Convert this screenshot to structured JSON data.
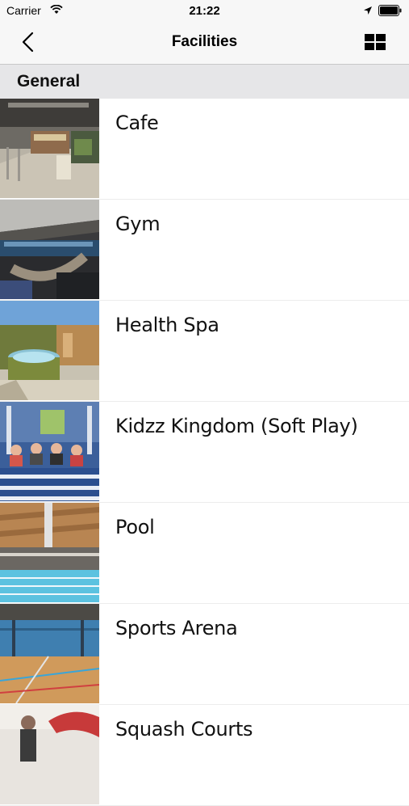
{
  "status_bar": {
    "carrier": "Carrier",
    "time": "21:22"
  },
  "nav": {
    "title": "Facilities",
    "back_icon": "chevron-left-icon",
    "grid_icon": "grid-view-icon"
  },
  "section": {
    "title": "General"
  },
  "facilities": [
    {
      "label": "Cafe",
      "image": "cafe-photo"
    },
    {
      "label": "Gym",
      "image": "gym-photo"
    },
    {
      "label": "Health Spa",
      "image": "health-spa-photo"
    },
    {
      "label": "Kidzz Kingdom (Soft Play)",
      "image": "soft-play-photo"
    },
    {
      "label": "Pool",
      "image": "pool-photo"
    },
    {
      "label": "Sports Arena",
      "image": "sports-arena-photo"
    },
    {
      "label": "Squash Courts",
      "image": "squash-courts-photo"
    }
  ]
}
